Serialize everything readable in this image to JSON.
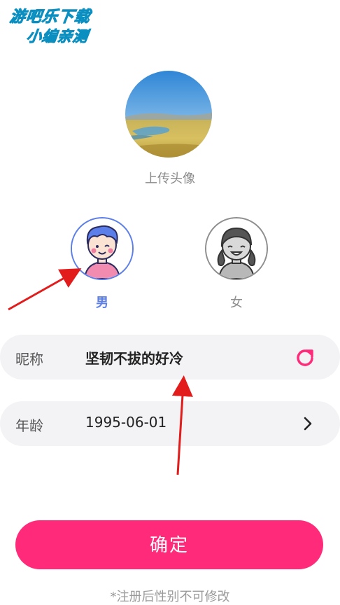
{
  "watermark": {
    "line1": "游吧乐下载",
    "line2": "小编亲测"
  },
  "profile": {
    "upload_avatar_label": "上传头像"
  },
  "gender": {
    "male_label": "男",
    "female_label": "女",
    "selected": "male"
  },
  "form": {
    "nickname_label": "昵称",
    "nickname_value": "坚韧不拔的好冷",
    "age_label": "年龄",
    "age_value": "1995-06-01"
  },
  "actions": {
    "confirm_label": "确定"
  },
  "footnote": "*注册后性别不可修改",
  "colors": {
    "accent_pink": "#ff2a7a",
    "male_blue": "#5b7ee8",
    "field_bg": "#f3f3f6",
    "annotation_red": "#e21b1b"
  },
  "icons": {
    "refresh": "refresh-icon",
    "chevron": "chevron-right-icon"
  }
}
